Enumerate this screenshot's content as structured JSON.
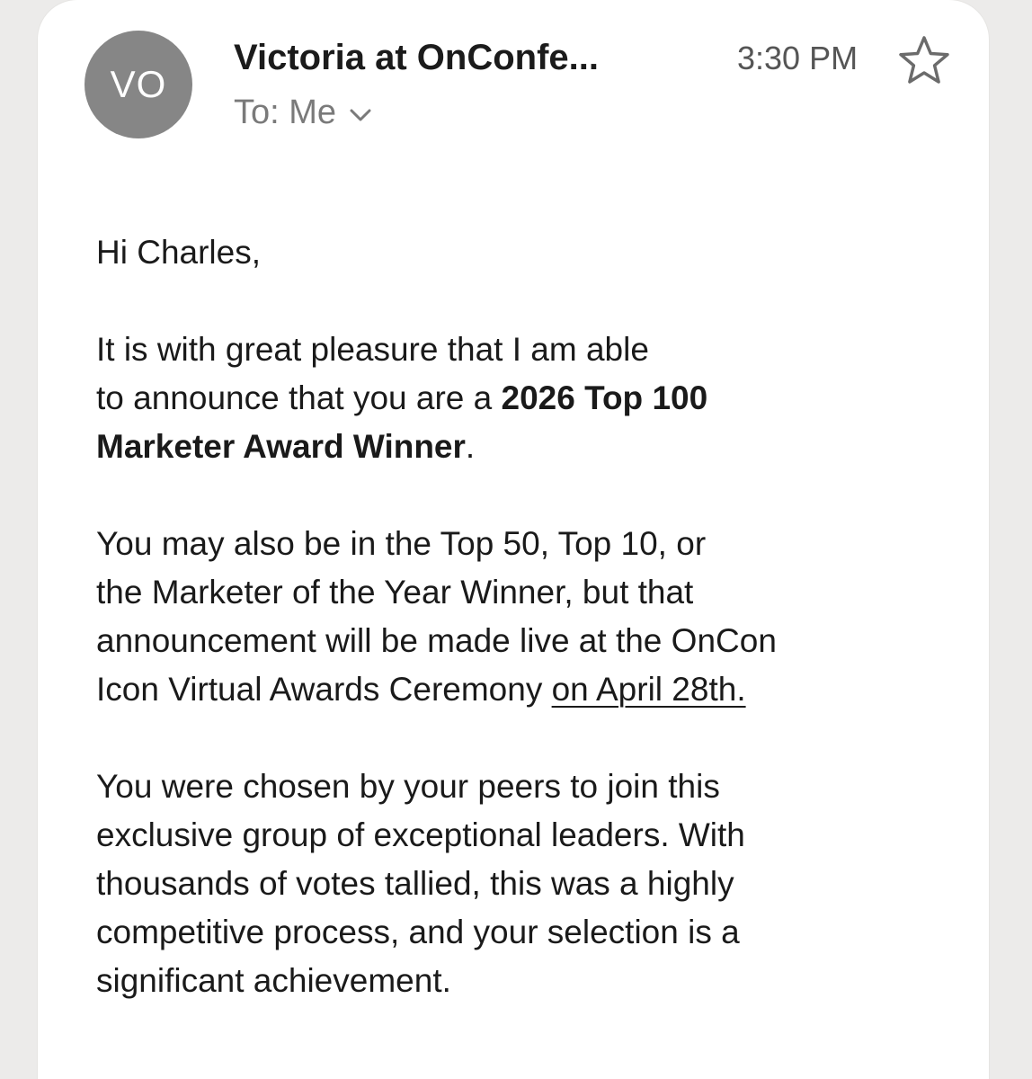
{
  "header": {
    "avatar_initials": "VO",
    "sender": "Victoria at OnConfe...",
    "time": "3:30 PM",
    "recipient": "To: Me"
  },
  "body": {
    "greeting": "Hi Charles,",
    "p1": {
      "line1": "It is with great pleasure that I am able",
      "line2_prefix": "to announce that you are a ",
      "award_part1": "2026 Top 100",
      "award_part2": "Marketer Award Winner",
      "line3_suffix": "."
    },
    "p2": {
      "line1": "You may also be in the Top 50, Top 10, or",
      "line2": "the Marketer of the Year Winner, but that",
      "line3": "announcement will be made live at the OnCon",
      "line4_prefix": "Icon Virtual Awards Ceremony ",
      "date_link": "on April 28th."
    },
    "p3": {
      "line1": "You were chosen by your peers to join this",
      "line2": "exclusive group of exceptional leaders. With",
      "line3": "thousands of votes tallied, this was a highly",
      "line4": "competitive process, and your selection is a",
      "line5": "significant achievement."
    }
  },
  "colors": {
    "avatar_bg": "#868686",
    "page_bg": "#ecebea",
    "text": "#1a1a1a",
    "muted": "#7a7a7a"
  },
  "icons": [
    "star-icon",
    "chevron-down-icon"
  ]
}
